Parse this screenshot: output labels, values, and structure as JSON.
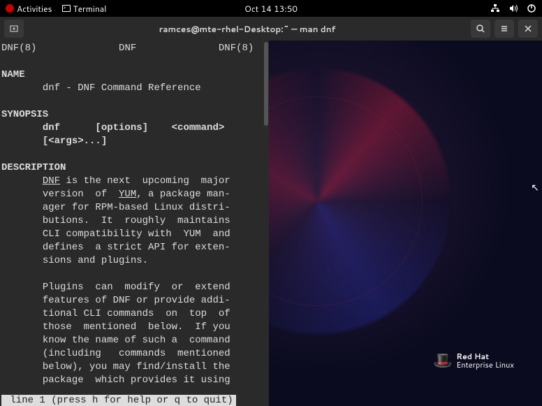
{
  "topbar": {
    "activities": "Activities",
    "terminal": "Terminal",
    "datetime": "Oct 14  13:50"
  },
  "window": {
    "title": "ramces@mte-rhel-Desktop:~ — man dnf"
  },
  "man": {
    "header_left": "DNF(8)",
    "header_center": "DNF",
    "header_right": "DNF(8)",
    "section_name": "NAME",
    "name_line": "dnf - DNF Command Reference",
    "section_synopsis": "SYNOPSIS",
    "synopsis_l1": "dnf      [options]    <command>",
    "synopsis_l2": "[<args>...]",
    "section_description": "DESCRIPTION",
    "desc_dnf": "DNF",
    "desc_p1a": " is the next  upcoming  major",
    "desc_p1b": "version  of  ",
    "desc_yum": "YUM",
    "desc_p1c": ", a package man-",
    "desc_p1d": "ager for RPM-based Linux distri-",
    "desc_p1e": "butions.  It  roughly  maintains",
    "desc_p1f": "CLI compatibility with  YUM  and",
    "desc_p1g": "defines  a strict API for exten-",
    "desc_p1h": "sions and plugins.",
    "desc_p2a": "Plugins  can  modify  or  extend",
    "desc_p2b": "features of DNF or provide addi-",
    "desc_p2c": "tional CLI commands  on  top  of",
    "desc_p2d": "those  mentioned  below.  If you",
    "desc_p2e": "know the name of such a  command",
    "desc_p2f": "(including   commands  mentioned",
    "desc_p2g": "below), you may find/install the",
    "desc_p2h": "package  which provides it using",
    "status": " line 1 (press h for help or q to quit)"
  },
  "branding": {
    "line1": "Red Hat",
    "line2": "Enterprise Linux"
  }
}
